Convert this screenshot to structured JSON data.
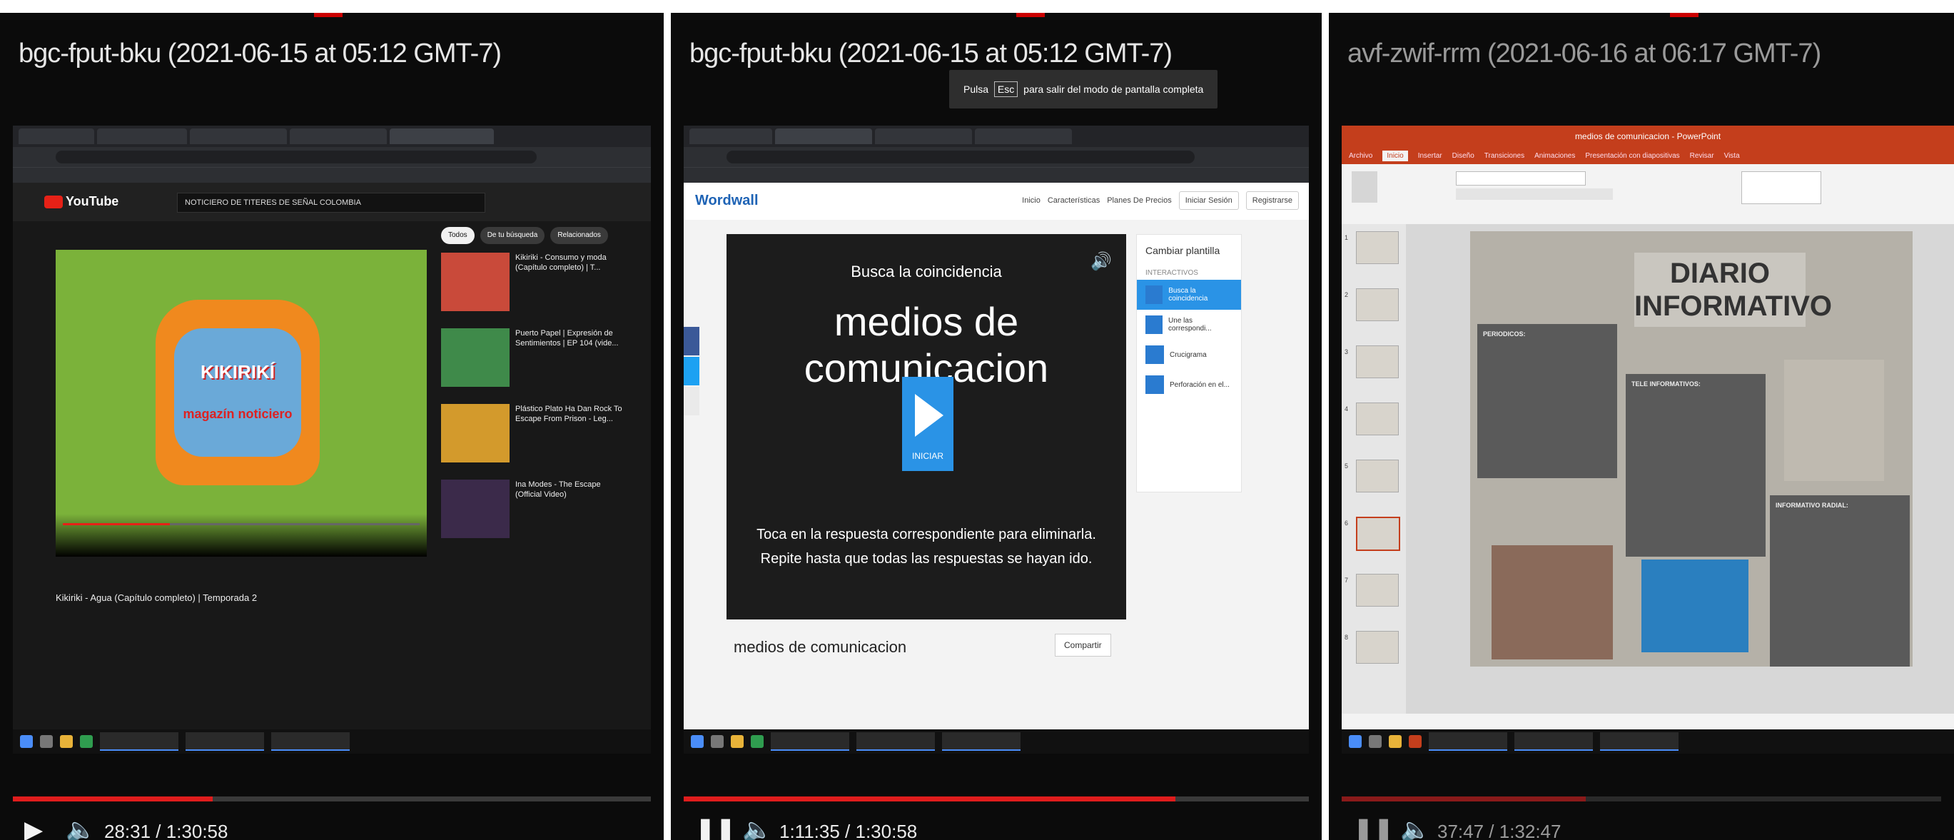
{
  "panels": [
    {
      "title": "bgc-fput-bku (2021-06-15 at 05:12 GMT-7)",
      "player": {
        "state": "paused",
        "time": "28:31 / 1:30:58",
        "progress": 0.313
      }
    },
    {
      "title": "bgc-fput-bku (2021-06-15 at 05:12 GMT-7)",
      "player": {
        "state": "playing",
        "time": "1:11:35 / 1:30:58",
        "progress": 0.787
      }
    },
    {
      "title": "avf-zwif-rrm (2021-06-16 at 06:17 GMT-7)",
      "player": {
        "state": "playing",
        "time": "37:47 / 1:32:47",
        "progress": 0.407
      }
    }
  ],
  "youtube": {
    "search_text": "NOTICIERO DE TITERES DE SEÑAL COLOMBIA",
    "video_title": "Kikiriki - Agua (Capítulo completo) | Temporada 2",
    "tv_logo": "KIKIRIKÍ",
    "tv_sub": "magazín noticiero",
    "chips": [
      "Todos",
      "De tu búsqueda",
      "Relacionados"
    ],
    "recs": [
      {
        "title": "Kikiriki - Consumo y moda (Capítulo completo) | T..."
      },
      {
        "title": "Puerto Papel | Expresión de Sentimientos | EP 104 (vide..."
      },
      {
        "title": "Plástico Plato Ha Dan Rock To Escape From Prison - Leg..."
      },
      {
        "title": "Ina Modes - The Escape (Official Video)"
      }
    ]
  },
  "wordwall": {
    "logo": "Wordwall",
    "nav": [
      "Inicio",
      "Características",
      "Planes De Precios"
    ],
    "login": "Iniciar Sesión",
    "register": "Registrarse",
    "find_match": "Busca la coincidencia",
    "activity_title": "medios de comunicacion",
    "start": "INICIAR",
    "instruction_1": "Toca en la respuesta correspondiente para eliminarla.",
    "instruction_2": "Repite hasta que todas las respuestas se hayan ido.",
    "game_title": "medios de comunicacion",
    "share": "Compartir",
    "side_title": "Cambiar plantilla",
    "side_sub": "INTERACTIVOS",
    "options": [
      "Busca la coincidencia",
      "Une las correspondi...",
      "Crucigrama",
      "Perforación en el..."
    ],
    "toast_pre": "Pulsa",
    "toast_key": "Esc",
    "toast_post": "para salir del modo de pantalla completa"
  },
  "powerpoint": {
    "doc_title": "medios de comunicacion - PowerPoint",
    "tabs": [
      "Archivo",
      "Inicio",
      "Insertar",
      "Diseño",
      "Transiciones",
      "Animaciones",
      "Presentación con diapositivas",
      "Revisar",
      "Vista"
    ],
    "slide_title_1": "DIARIO",
    "slide_title_2": "INFORMATIVO",
    "box1_head": "PERIODICOS:",
    "box2_head": "TELE INFORMATIVOS:",
    "box3_head": "INFORMATIVO RADIAL:"
  },
  "colors": {
    "progress": "#e01c1c",
    "wordwall_blue": "#2a93e6",
    "pp_orange": "#c43e1c"
  }
}
